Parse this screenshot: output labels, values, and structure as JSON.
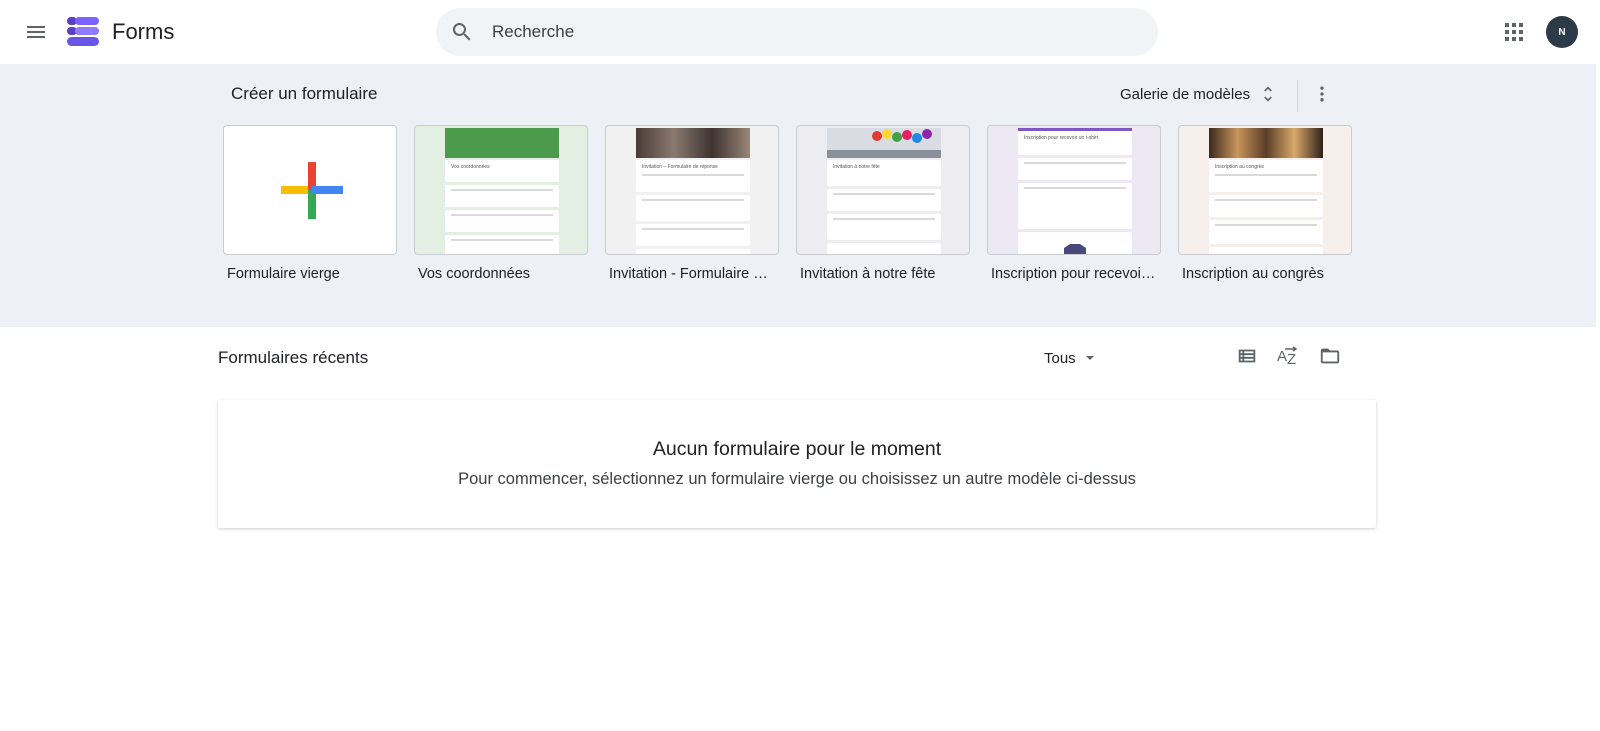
{
  "header": {
    "app_title": "Forms",
    "search_placeholder": "Recherche",
    "avatar_text": "N"
  },
  "gallery": {
    "title": "Créer un formulaire",
    "toggle_label": "Galerie de modèles",
    "templates": [
      {
        "label": "Formulaire vierge",
        "thumb_title": "",
        "theme": "#ffffff"
      },
      {
        "label": "Vos coordonnées",
        "thumb_title": "Vos coordonnées",
        "theme": "#e3efe3"
      },
      {
        "label": "Invitation - Formulaire de réponse",
        "thumb_title": "Invitation – Formulaire de réponse",
        "theme": "#f1f1f1"
      },
      {
        "label": "Invitation à notre fête",
        "thumb_title": "Invitation à notre fête",
        "theme": "#ececf1"
      },
      {
        "label": "Inscription pour recevoir un t-shirt",
        "thumb_title": "Inscription pour recevoir un t-shirt",
        "theme": "#ece9f5"
      },
      {
        "label": "Inscription au congrès",
        "thumb_title": "Inscription au congrès",
        "theme": "#f6efeb"
      }
    ]
  },
  "recent": {
    "title": "Formulaires récents",
    "owner_filter": "Tous",
    "empty_title": "Aucun formulaire pour le moment",
    "empty_subtitle": "Pour commencer, sélectionnez un formulaire vierge ou choisissez un autre modèle ci-dessus"
  },
  "colors": {
    "gallery_bg": "#edf0f5",
    "plus_red": "#ea4335",
    "plus_blue": "#4285f4",
    "plus_yellow": "#fbbc04",
    "plus_green": "#34a853",
    "logo_purple": "#7248b9"
  }
}
